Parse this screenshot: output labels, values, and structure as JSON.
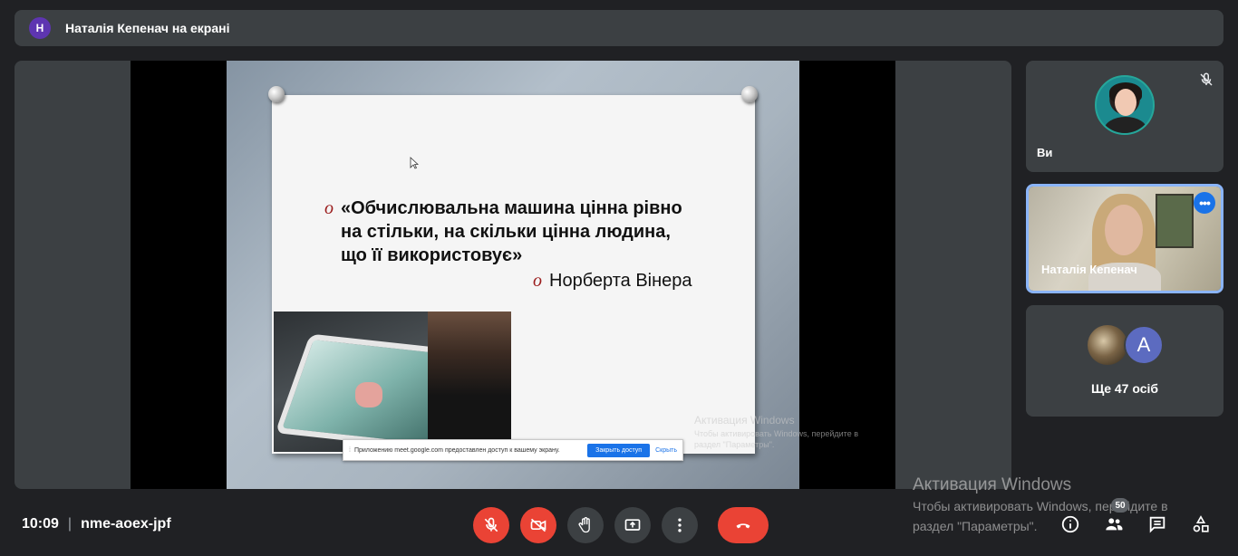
{
  "topbar": {
    "avatar_letter": "Н",
    "title": "Наталія Кепенач на екрані"
  },
  "slide": {
    "bullet": "o",
    "quote": "«Обчислювальна машина цінна рівно\nна стільки, на скільки цінна людина,\nщо її використовує»",
    "author": "Норберта Вінера"
  },
  "sharebar": {
    "handle": "⁞",
    "text": "Приложению meet.google.com предоставлен доступ к вашему экрану.",
    "stop_label": "Закрыть доступ",
    "hide_label": "Скрыть"
  },
  "watermark_small": {
    "title": "Активация Windows",
    "sub": "Чтобы активировать Windows, перейдите в раздел \"Параметры\"."
  },
  "watermark_big": {
    "title": "Активация Windows",
    "sub_line1": "Чтобы активировать Windows, перейдите в",
    "sub_line2": "раздел \"Параметры\"."
  },
  "participants": {
    "self_label": "Ви",
    "presenter_name": "Наталія Кепенач",
    "more_avatar_letter": "A",
    "more_label": "Ще 47 осіб"
  },
  "meeting": {
    "time": "10:09",
    "separator": "|",
    "code": "nme-aoex-jpf"
  },
  "people_count": "50",
  "colors": {
    "end_call": "#ea4335",
    "accent": "#1a73e8",
    "surface": "#3c4043",
    "background": "#202124"
  }
}
